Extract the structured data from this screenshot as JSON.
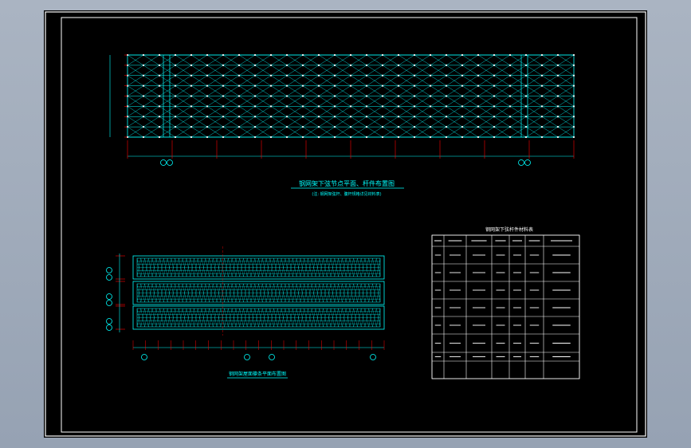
{
  "drawing": {
    "top_plan": {
      "grid_bubbles": [
        "",
        "",
        "",
        ""
      ],
      "title_line1": "钢网架下弦节点平面、杆件布置图",
      "title_line2": "(注: 钢网架弦杆、腹杆规格详见材料表)"
    },
    "bottom_plan": {
      "grid_bubbles": [
        "",
        "",
        "",
        ""
      ],
      "row_labels": [
        "",
        "",
        ""
      ],
      "title": "钢网架屋面檩条平面布置图"
    },
    "material_table": {
      "title": "钢网架下弦杆件材料表",
      "headers": [
        "",
        "",
        "",
        "",
        "",
        "",
        ""
      ],
      "rows": 7
    }
  },
  "colors": {
    "background": "#000000",
    "frame": "#ffffff",
    "line": "#00ffff",
    "accent": "#ff0000",
    "text": "#ffffff"
  }
}
